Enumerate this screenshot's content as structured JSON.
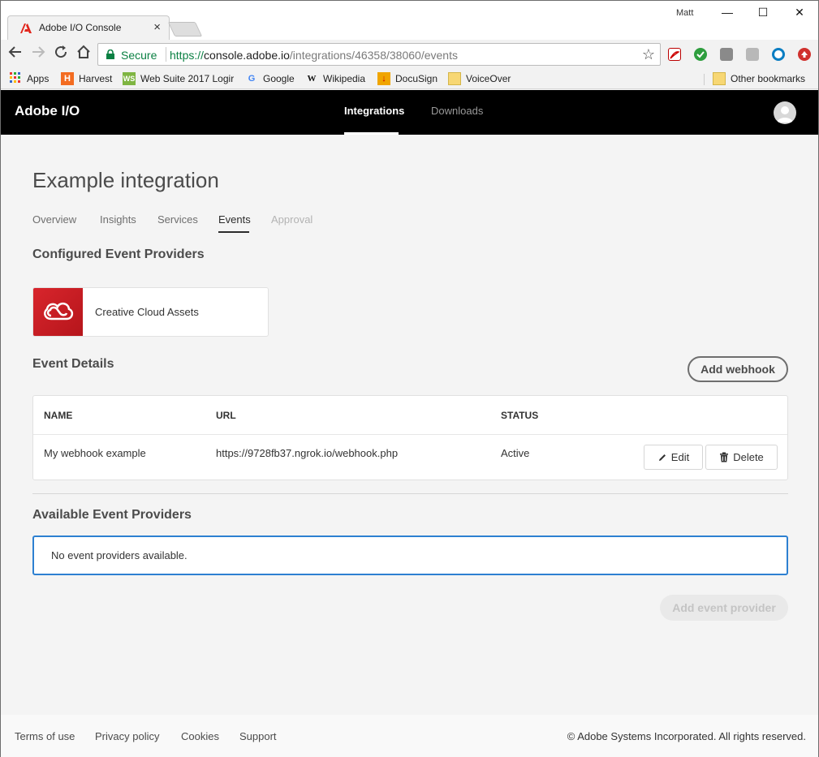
{
  "browser": {
    "tab_title": "Adobe I/O Console",
    "tab_close": "×",
    "profile_name": "Matt",
    "window_controls": {
      "minimize": "—",
      "maximize": "☐",
      "close": "✕"
    },
    "address": {
      "secure_label": "Secure",
      "url_scheme": "https://",
      "url_host": "console.adobe.io",
      "url_path": "/integrations/46358/38060/events"
    },
    "bookmarks": [
      {
        "label": "Apps",
        "icon": "apps-grid-icon"
      },
      {
        "label": "Harvest",
        "icon": "harvest-icon"
      },
      {
        "label": "Web Suite 2017 Logir",
        "icon": "websuite-icon"
      },
      {
        "label": "Google",
        "icon": "google-icon"
      },
      {
        "label": "Wikipedia",
        "icon": "wikipedia-icon"
      },
      {
        "label": "DocuSign",
        "icon": "docusign-icon"
      },
      {
        "label": "VoiceOver",
        "icon": "folder-icon"
      }
    ],
    "other_bookmarks": "Other bookmarks"
  },
  "header": {
    "brand": "Adobe I/O",
    "nav": [
      {
        "label": "Integrations",
        "active": true
      },
      {
        "label": "Downloads",
        "active": false
      }
    ]
  },
  "page": {
    "title": "Example integration",
    "tabs": [
      {
        "label": "Overview",
        "state": "normal"
      },
      {
        "label": "Insights",
        "state": "normal"
      },
      {
        "label": "Services",
        "state": "normal"
      },
      {
        "label": "Events",
        "state": "active"
      },
      {
        "label": "Approval",
        "state": "disabled"
      }
    ]
  },
  "configured": {
    "title": "Configured Event Providers",
    "providers": [
      {
        "name": "Creative Cloud Assets",
        "icon": "creative-cloud-icon",
        "color": "#d8252c"
      }
    ]
  },
  "event_details": {
    "title": "Event Details",
    "add_webhook_label": "Add webhook",
    "columns": [
      "NAME",
      "URL",
      "STATUS"
    ],
    "rows": [
      {
        "name": "My webhook example",
        "url": "https://9728fb37.ngrok.io/webhook.php",
        "status": "Active",
        "edit_label": "Edit",
        "delete_label": "Delete"
      }
    ]
  },
  "available": {
    "title": "Available Event Providers",
    "empty_message": "No event providers available.",
    "add_provider_label": "Add event provider"
  },
  "footer": {
    "links": [
      "Terms of use",
      "Privacy policy",
      "Cookies",
      "Support"
    ],
    "copyright": "© Adobe Systems Incorporated. All rights reserved."
  },
  "colors": {
    "accent_blue": "#2d80d1",
    "header_bg": "#000000",
    "secure_green": "#0b8043",
    "cc_red": "#d8252c"
  }
}
